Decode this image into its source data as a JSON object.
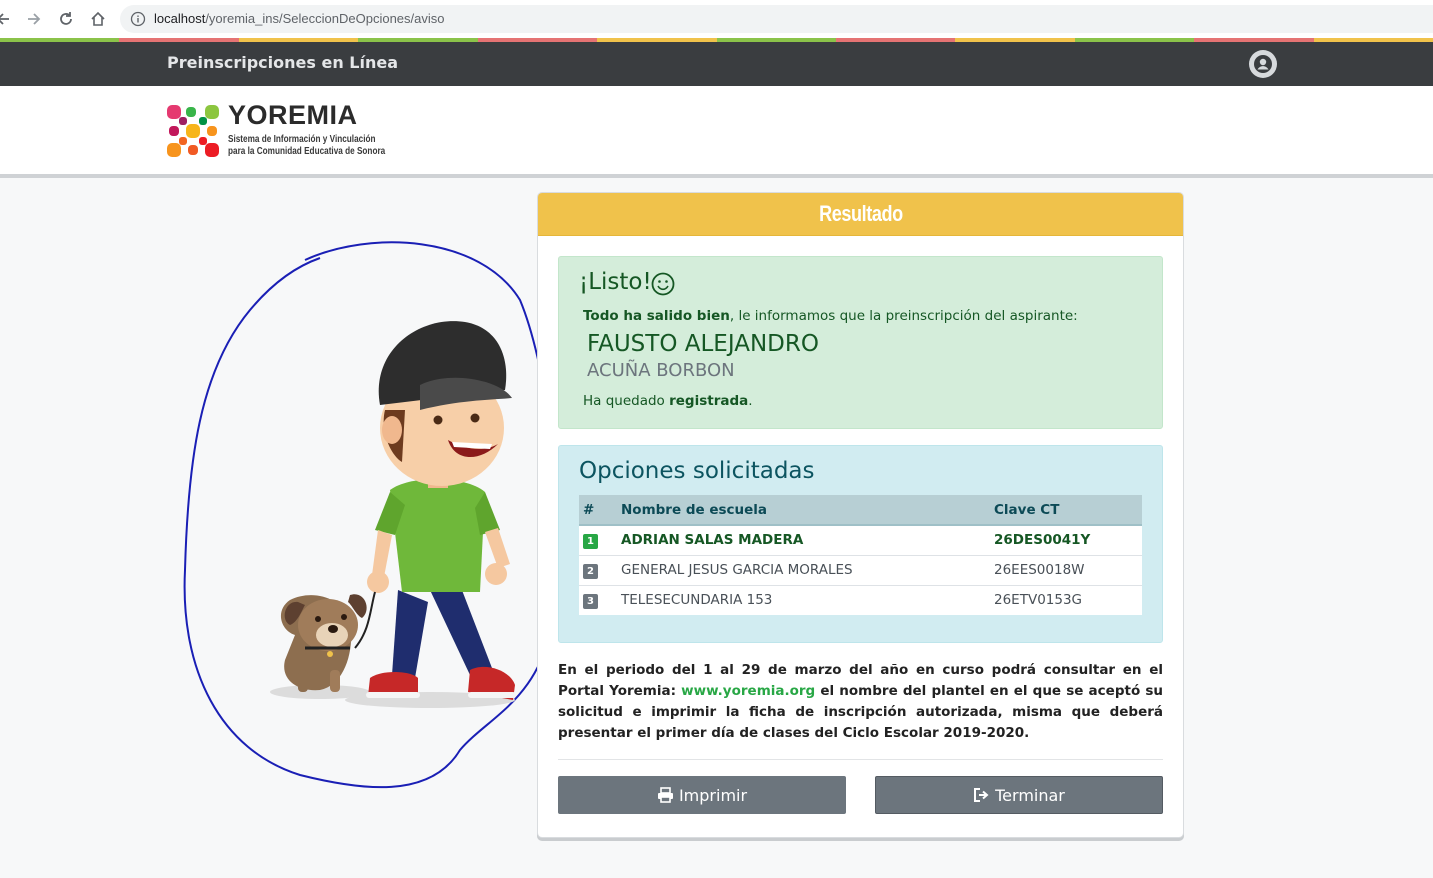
{
  "browser": {
    "url_host": "localhost",
    "url_path": "/yoremia_ins/SeleccionDeOpciones/aviso"
  },
  "header": {
    "brand": "Preinscripciones en Línea"
  },
  "logo": {
    "title": "YOREMIA",
    "subtitle_line1": "Sistema de Información y Vinculación",
    "subtitle_line2": "para la Comunidad Educativa de Sonora"
  },
  "card": {
    "title": "Resultado",
    "success": {
      "heading": "¡Listo!",
      "intro_bold": "Todo ha salido bien",
      "intro_rest": ", le informamos que la preinscripción del aspirante:",
      "first_name": "FAUSTO ALEJANDRO",
      "last_name": "ACUÑA BORBON",
      "status_prefix": "Ha quedado ",
      "status_bold": "registrada",
      "status_suffix": "."
    },
    "options": {
      "title": "Opciones solicitadas",
      "columns": [
        "#",
        "Nombre de escuela",
        "Clave CT"
      ],
      "rows": [
        {
          "n": "1",
          "school": "ADRIAN SALAS MADERA",
          "clave": "26DES0041Y"
        },
        {
          "n": "2",
          "school": "GENERAL JESUS GARCIA MORALES",
          "clave": "26EES0018W"
        },
        {
          "n": "3",
          "school": "TELESECUNDARIA 153",
          "clave": "26ETV0153G"
        }
      ]
    },
    "notice": {
      "before_link": "En el periodo del 1 al 29 de marzo del año en curso podrá consultar en el Portal Yoremia: ",
      "link": "www.yoremia.org",
      "after_link": " el nombre del plantel en el que se aceptó su solicitud e imprimir la ficha de inscripción autorizada, misma que deberá presentar el primer día de clases del Ciclo Escolar 2019-2020."
    },
    "buttons": {
      "print": "Imprimir",
      "finish": "Terminar"
    }
  },
  "colors": {
    "header_bg": "#3a3d40",
    "card_header": "#f0c24b",
    "success_bg": "#d4edda",
    "info_bg": "#d1ecf1",
    "button": "#6c757d"
  }
}
